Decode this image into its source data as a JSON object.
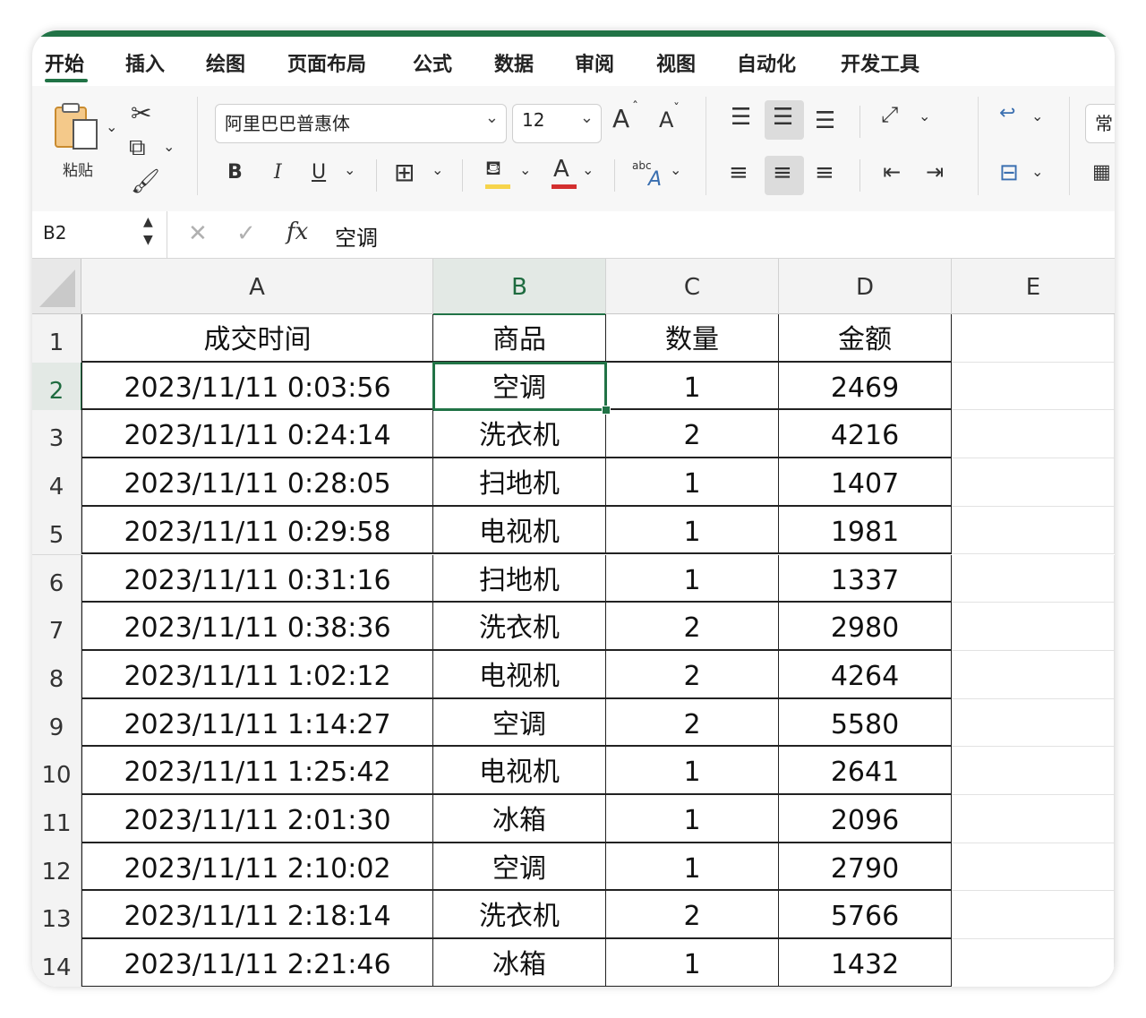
{
  "tabs": [
    "开始",
    "插入",
    "绘图",
    "页面布局",
    "公式",
    "数据",
    "审阅",
    "视图",
    "自动化",
    "开发工具"
  ],
  "ribbon": {
    "paste_label": "粘贴",
    "font_name": "阿里巴巴普惠体",
    "font_size": "12",
    "grow_font": "A",
    "shrink_font": "A",
    "bold": "B",
    "italic": "I",
    "underline": "U",
    "font_color_letter": "A",
    "phonetic_text": "abc",
    "format_cut": "常"
  },
  "formula_bar": {
    "name_box": "B2",
    "fx": "fx",
    "content": "空调"
  },
  "columns": [
    "A",
    "B",
    "C",
    "D",
    "E"
  ],
  "selected_cell": "B2",
  "table": {
    "headers": [
      "成交时间",
      "商品",
      "数量",
      "金额"
    ],
    "rows": [
      [
        "2023/11/11 0:03:56",
        "空调",
        "1",
        "2469"
      ],
      [
        "2023/11/11 0:24:14",
        "洗衣机",
        "2",
        "4216"
      ],
      [
        "2023/11/11 0:28:05",
        "扫地机",
        "1",
        "1407"
      ],
      [
        "2023/11/11 0:29:58",
        "电视机",
        "1",
        "1981"
      ],
      [
        "2023/11/11 0:31:16",
        "扫地机",
        "1",
        "1337"
      ],
      [
        "2023/11/11 0:38:36",
        "洗衣机",
        "2",
        "2980"
      ],
      [
        "2023/11/11 1:02:12",
        "电视机",
        "2",
        "4264"
      ],
      [
        "2023/11/11 1:14:27",
        "空调",
        "2",
        "5580"
      ],
      [
        "2023/11/11 1:25:42",
        "电视机",
        "1",
        "2641"
      ],
      [
        "2023/11/11 2:01:30",
        "冰箱",
        "1",
        "2096"
      ],
      [
        "2023/11/11 2:10:02",
        "空调",
        "1",
        "2790"
      ],
      [
        "2023/11/11 2:18:14",
        "洗衣机",
        "2",
        "5766"
      ],
      [
        "2023/11/11 2:21:46",
        "冰箱",
        "1",
        "1432"
      ]
    ]
  },
  "row_numbers": [
    "1",
    "2",
    "3",
    "4",
    "5",
    "6",
    "7",
    "8",
    "9",
    "10",
    "11",
    "12",
    "13",
    "14"
  ],
  "colors": {
    "accent": "#217346"
  }
}
